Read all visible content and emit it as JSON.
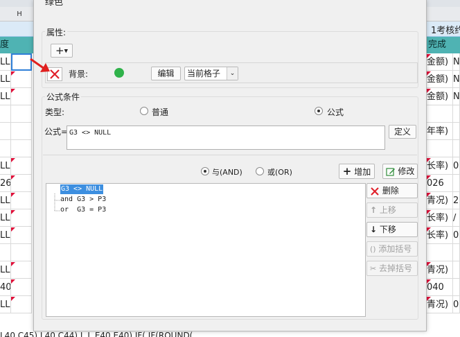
{
  "spreadsheet": {
    "column_header": "H",
    "header_right": "1考核约",
    "teal_left": "度",
    "teal_right": "完成",
    "left_cells": [
      "LL)",
      "LL)",
      "LL)",
      "",
      "",
      "",
      "LL)",
      "26",
      "LL)",
      "LL)",
      "LL)",
      "",
      "LL)",
      "40",
      "LL)"
    ],
    "right_cells": [
      {
        "a": "金额)",
        "b": "N"
      },
      {
        "a": "金额)",
        "b": "N"
      },
      {
        "a": "金额)",
        "b": "N"
      },
      {
        "a": "",
        "b": ""
      },
      {
        "a": "年率)",
        "b": ""
      },
      {
        "a": "",
        "b": ""
      },
      {
        "a": "长率)",
        "b": "0"
      },
      {
        "a": "026",
        "b": ""
      },
      {
        "a": "青况)",
        "b": "2"
      },
      {
        "a": "长率)",
        "b": "/"
      },
      {
        "a": "长率)",
        "b": "0"
      },
      {
        "a": "",
        "b": ""
      },
      {
        "a": "青况)",
        "b": ""
      },
      {
        "a": "040",
        "b": ""
      },
      {
        "a": "青况)",
        "b": "0"
      }
    ],
    "bottom_text": "L40 C45) L40 C44)  L L E40 E40)       IF(   IF(ROUND("
  },
  "dialog": {
    "title": "绿色",
    "attributes": {
      "group_label": "属性:",
      "add_button": "+",
      "property_name": "背景:",
      "color_dot": "#2fb24a",
      "edit_button": "编辑",
      "scope_value": "当前格子"
    },
    "formula": {
      "group_label": "公式条件",
      "type_label": "类型:",
      "option_normal": "普通",
      "option_formula": "公式",
      "formula_label": "公式=",
      "formula_value": "G3 <> NULL",
      "define_button": "定义",
      "logic_and": "与(AND)",
      "logic_or": "或(OR)",
      "add_button": "增加",
      "modify_button": "修改",
      "conditions": [
        "G3 <> NULL",
        "and G3 > P3",
        "or  G3 = P3"
      ],
      "delete_button": "删除",
      "up_button": "上移",
      "down_button": "下移",
      "add_bracket_button": "添加括号",
      "remove_bracket_button": "去掉括号"
    }
  },
  "colors": {
    "teal_header": "#4fb3b3",
    "selection_blue": "#3d8fe0",
    "red_marker": "#e0103a"
  }
}
